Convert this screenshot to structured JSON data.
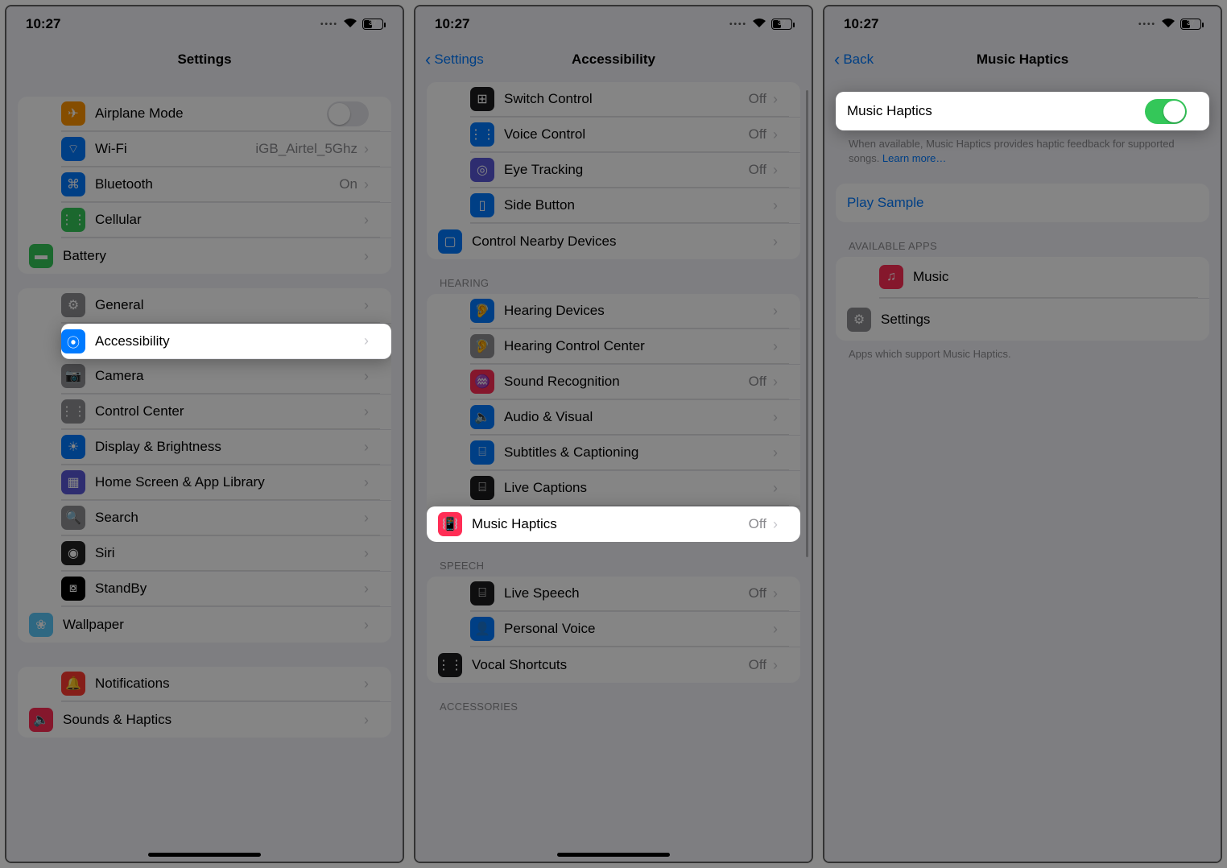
{
  "status": {
    "time": "10:27",
    "battery_pct": "37"
  },
  "screen1": {
    "title": "Settings",
    "g1": [
      {
        "icon": "airplane-icon",
        "color": "#ff9500",
        "glyph": "✈",
        "label": "Airplane Mode",
        "toggle": false
      },
      {
        "icon": "wifi-icon",
        "color": "#007aff",
        "glyph": "⌔",
        "label": "Wi-Fi",
        "value": "iGB_Airtel_5Ghz"
      },
      {
        "icon": "bluetooth-icon",
        "color": "#007aff",
        "glyph": "⌘",
        "label": "Bluetooth",
        "value": "On"
      },
      {
        "icon": "cellular-icon",
        "color": "#34c759",
        "glyph": "⋮⋮",
        "label": "Cellular"
      },
      {
        "icon": "battery-icon",
        "color": "#34c759",
        "glyph": "▬",
        "label": "Battery"
      }
    ],
    "g2": [
      {
        "icon": "general-icon",
        "color": "#8e8e93",
        "glyph": "⚙",
        "label": "General"
      },
      {
        "icon": "accessibility-icon",
        "color": "#007aff",
        "glyph": "⦿",
        "label": "Accessibility",
        "highlight": true
      },
      {
        "icon": "camera-icon",
        "color": "#8e8e93",
        "glyph": "📷",
        "label": "Camera"
      },
      {
        "icon": "control-center-icon",
        "color": "#8e8e93",
        "glyph": "⋮⋮",
        "label": "Control Center"
      },
      {
        "icon": "display-icon",
        "color": "#007aff",
        "glyph": "☀",
        "label": "Display & Brightness"
      },
      {
        "icon": "home-screen-icon",
        "color": "#5856d6",
        "glyph": "▦",
        "label": "Home Screen & App Library"
      },
      {
        "icon": "search-icon",
        "color": "#8e8e93",
        "glyph": "🔍",
        "label": "Search"
      },
      {
        "icon": "siri-icon",
        "color": "#222",
        "glyph": "◉",
        "label": "Siri"
      },
      {
        "icon": "standby-icon",
        "color": "#000",
        "glyph": "⧇",
        "label": "StandBy"
      },
      {
        "icon": "wallpaper-icon",
        "color": "#5ac8fa",
        "glyph": "❀",
        "label": "Wallpaper"
      }
    ],
    "g3": [
      {
        "icon": "notifications-icon",
        "color": "#ff3b30",
        "glyph": "🔔",
        "label": "Notifications"
      },
      {
        "icon": "sounds-icon",
        "color": "#ff2d55",
        "glyph": "🔈",
        "label": "Sounds & Haptics"
      }
    ]
  },
  "screen2": {
    "back": "Settings",
    "title": "Accessibility",
    "g1": [
      {
        "icon": "switch-control-icon",
        "color": "#1c1c1e",
        "glyph": "⊞",
        "label": "Switch Control",
        "value": "Off"
      },
      {
        "icon": "voice-control-icon",
        "color": "#007aff",
        "glyph": "⋮⋮",
        "label": "Voice Control",
        "value": "Off"
      },
      {
        "icon": "eye-tracking-icon",
        "color": "#5856d6",
        "glyph": "◎",
        "label": "Eye Tracking",
        "value": "Off"
      },
      {
        "icon": "side-button-icon",
        "color": "#007aff",
        "glyph": "▯",
        "label": "Side Button"
      },
      {
        "icon": "nearby-devices-icon",
        "color": "#007aff",
        "glyph": "▢",
        "label": "Control Nearby Devices"
      }
    ],
    "h2": "Hearing",
    "g2": [
      {
        "icon": "hearing-devices-icon",
        "color": "#007aff",
        "glyph": "🦻",
        "label": "Hearing Devices"
      },
      {
        "icon": "hearing-cc-icon",
        "color": "#8e8e93",
        "glyph": "🦻",
        "label": "Hearing Control Center"
      },
      {
        "icon": "sound-recognition-icon",
        "color": "#ff2d55",
        "glyph": "♒",
        "label": "Sound Recognition",
        "value": "Off"
      },
      {
        "icon": "audio-visual-icon",
        "color": "#007aff",
        "glyph": "🔈",
        "label": "Audio & Visual"
      },
      {
        "icon": "subtitles-icon",
        "color": "#007aff",
        "glyph": "⌸",
        "label": "Subtitles & Captioning"
      },
      {
        "icon": "live-captions-icon",
        "color": "#1c1c1e",
        "glyph": "⌸",
        "label": "Live Captions"
      },
      {
        "icon": "music-haptics-icon",
        "color": "#ff2d55",
        "glyph": "📳",
        "label": "Music Haptics",
        "value": "Off",
        "highlight": true
      }
    ],
    "h3": "Speech",
    "g3": [
      {
        "icon": "live-speech-icon",
        "color": "#1c1c1e",
        "glyph": "⌸",
        "label": "Live Speech",
        "value": "Off"
      },
      {
        "icon": "personal-voice-icon",
        "color": "#007aff",
        "glyph": "👤",
        "label": "Personal Voice"
      },
      {
        "icon": "vocal-shortcuts-icon",
        "color": "#1c1c1e",
        "glyph": "⋮⋮",
        "label": "Vocal Shortcuts",
        "value": "Off"
      }
    ],
    "h4": "Accessories"
  },
  "screen3": {
    "back": "Back",
    "title": "Music Haptics",
    "toggle_label": "Music Haptics",
    "footer": "When available, Music Haptics provides haptic feedback for supported songs. ",
    "learn_more": "Learn more…",
    "play_sample": "Play Sample",
    "h_apps": "Available Apps",
    "apps": [
      {
        "icon": "music-app-icon",
        "color": "#ff2d55",
        "glyph": "♫",
        "label": "Music"
      },
      {
        "icon": "settings-app-icon",
        "color": "#8e8e93",
        "glyph": "⚙",
        "label": "Settings"
      }
    ],
    "apps_footer": "Apps which support Music Haptics."
  }
}
